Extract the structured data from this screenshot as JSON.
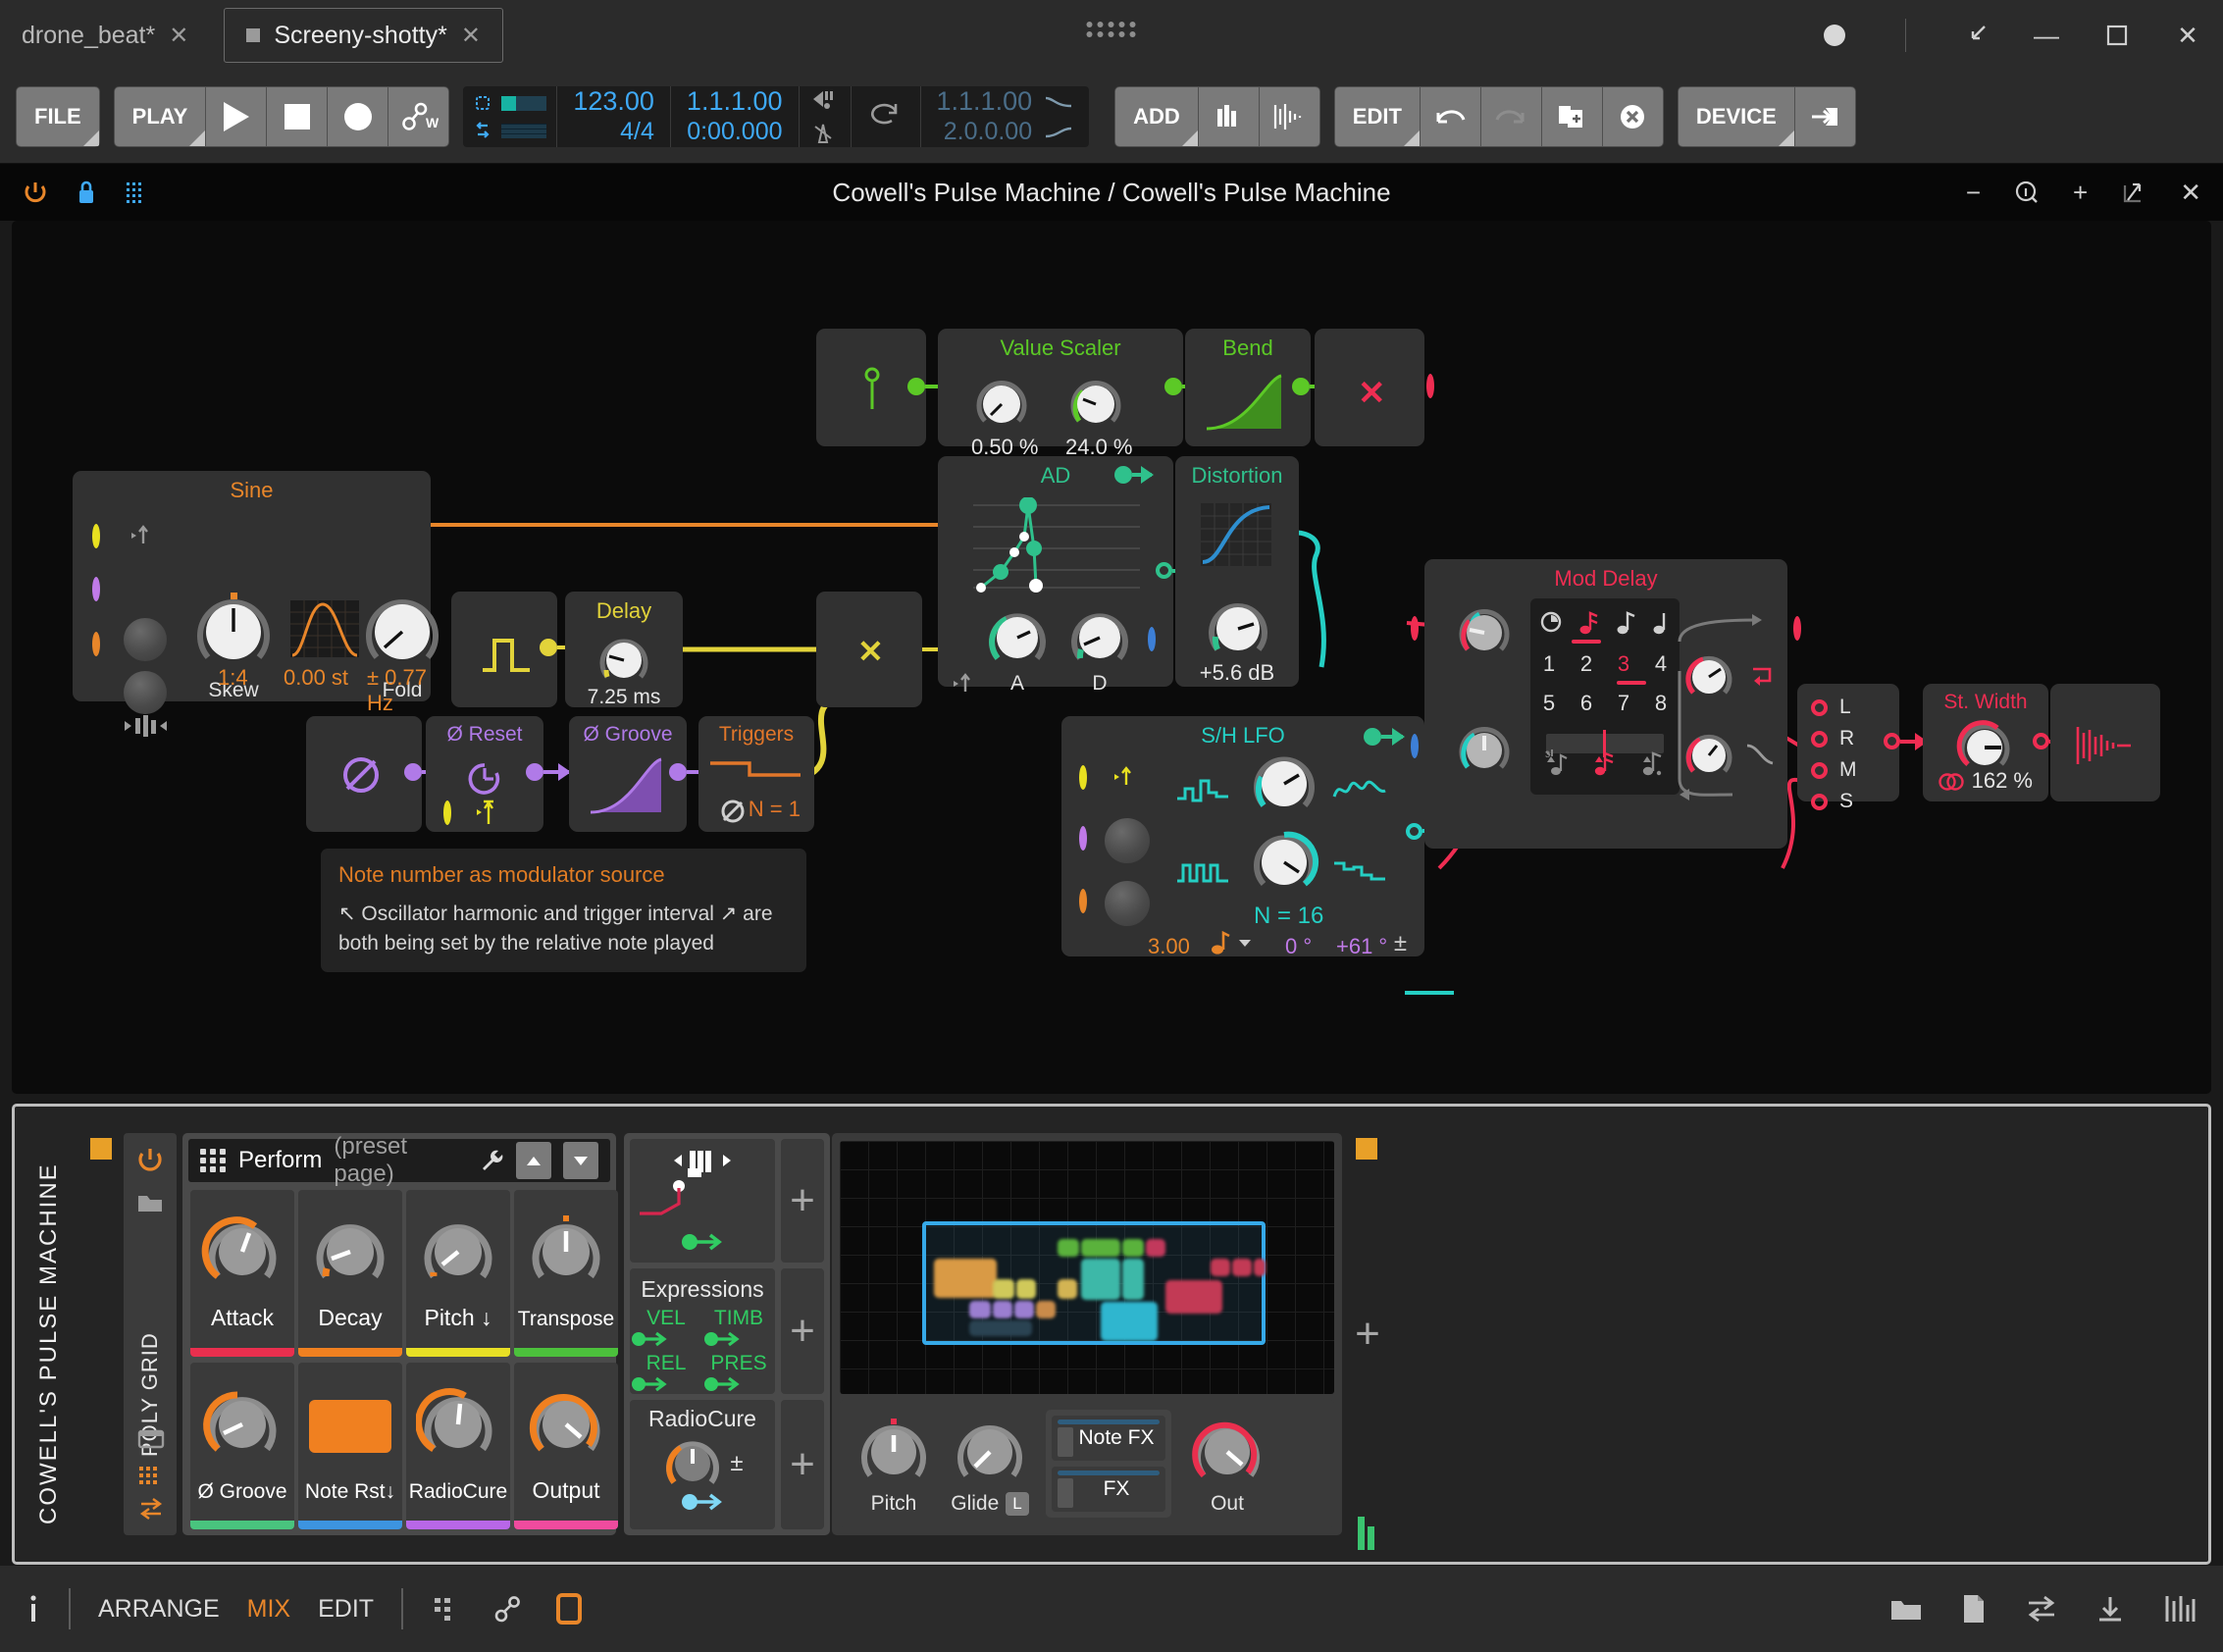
{
  "window": {
    "tabs": [
      {
        "label": "drone_beat*",
        "active": false,
        "close": "✕"
      },
      {
        "label": "Screeny-shotty*",
        "active": true,
        "close": "✕"
      }
    ],
    "controls": {
      "minimize": "—",
      "maximize": "❐",
      "close": "✕",
      "restore": "⤡"
    }
  },
  "transport": {
    "file_label": "FILE",
    "play_label": "PLAY",
    "buttons": [
      "play-icon",
      "stop-icon",
      "record-icon",
      "automation-write-icon"
    ],
    "tempo": "123.00",
    "signature": "4/4",
    "position_bars": "1.1.1.00",
    "position_time": "0:00.000",
    "loop_start": "1.1.1.00",
    "loop_end": "2.0.0.00",
    "add_label": "ADD",
    "edit_label": "EDIT",
    "device_label": "DEVICE"
  },
  "device_header": {
    "title": "Cowell's Pulse Machine / Cowell's Pulse Machine",
    "power_icon": "power-icon",
    "lock_icon": "lock-icon",
    "grid_icon": "grid-icon",
    "right_icons": [
      "minimize-icon",
      "info-icon",
      "plus-icon",
      "popout-icon",
      "close-icon"
    ]
  },
  "grid": {
    "modules": [
      {
        "name": "Sine",
        "color": "#e8862a",
        "params": [
          {
            "label": "Skew"
          },
          {
            "label": "Fold"
          }
        ],
        "values": [
          "1:4",
          "0.00 st",
          "± 0.77 Hz"
        ]
      },
      {
        "name": "Value Scaler",
        "color": "#5cc926",
        "values": [
          "0.50 %",
          "24.0 %"
        ]
      },
      {
        "name": "Bend",
        "color": "#5cc926",
        "values": []
      },
      {
        "name": "AD",
        "color": "#2fc18c",
        "params": [
          {
            "label": "A"
          },
          {
            "label": "D"
          }
        ],
        "values": []
      },
      {
        "name": "Distortion",
        "color": "#2fc18c",
        "values": [
          "+5.6 dB"
        ]
      },
      {
        "name": "Delay",
        "color": "#e2d33a",
        "values": [
          "7.25 ms"
        ]
      },
      {
        "name": "Ø Reset",
        "color": "#b07ae8",
        "values": []
      },
      {
        "name": "Ø Groove",
        "color": "#b07ae8",
        "values": []
      },
      {
        "name": "Triggers",
        "color": "#e2772a",
        "values": [
          "N = 1"
        ]
      },
      {
        "name": "S/H LFO",
        "color": "#25cfc4",
        "values": [
          "N = 16",
          "3.00",
          "0 °",
          "+61 °"
        ]
      },
      {
        "name": "Mod Delay",
        "color": "#ef2d52",
        "steps_top": [
          "1",
          "2",
          "3",
          "4"
        ],
        "steps_bottom": [
          "5",
          "6",
          "7",
          "8"
        ],
        "selected_step": "3"
      },
      {
        "name": "St. Width",
        "color": "#ef2d52",
        "values": [
          "162 %"
        ]
      }
    ],
    "channel_labels": [
      "L",
      "R",
      "M",
      "S"
    ],
    "note": {
      "title": "Note number as modulator source",
      "body": "↖ Oscillator harmonic and trigger interval ↗ are both being set by the relative note played"
    }
  },
  "bottom": {
    "device_name": "COWELL'S PULSE MACHINE",
    "engine_label": "POLY GRID",
    "preset_page": {
      "title": "Perform",
      "subtitle": "(preset page)",
      "wrench_icon": "wrench-icon",
      "up_icon": "chevron-up-icon",
      "down_icon": "chevron-down-icon"
    },
    "macros": [
      {
        "label": "Attack",
        "color": "#ea2f4e"
      },
      {
        "label": "Decay",
        "color": "#f08020"
      },
      {
        "label": "Pitch ↓",
        "color": "#e8e025"
      },
      {
        "label": "Transpose",
        "color": "#4cc13c"
      },
      {
        "label": "Ø Groove",
        "color": "#49c47e"
      },
      {
        "label": "Note Rst↓",
        "color": "#3d94e0"
      },
      {
        "label": "RadioCure",
        "color": "#b867e8"
      },
      {
        "label": "Output",
        "color": "#ef4b9e"
      }
    ],
    "expressions": {
      "title": "Expressions",
      "items": [
        "VEL",
        "TIMB",
        "REL",
        "PRES"
      ]
    },
    "radiocure": {
      "title": "RadioCure",
      "pm": "±"
    },
    "plus_label": "+",
    "voice_controls": [
      {
        "label": "Pitch"
      },
      {
        "label": "Glide"
      }
    ],
    "glide_badge": "L",
    "routing": [
      {
        "label": "Note FX"
      },
      {
        "label": "FX"
      }
    ],
    "out": {
      "label": "Out"
    }
  },
  "status_bar": {
    "info_icon": "info-icon",
    "views": [
      {
        "label": "ARRANGE",
        "active": false
      },
      {
        "label": "MIX",
        "active": true
      },
      {
        "label": "EDIT",
        "active": false
      }
    ],
    "right_icons": [
      "browser-icon",
      "notes-icon",
      "io-icon",
      "automation-icon",
      "mixer-icon"
    ]
  },
  "colors": {
    "accent_orange": "#e8862a",
    "blue": "#3fa9f5",
    "green": "#5cc926",
    "teal": "#2fc18c",
    "cyan": "#25cfc4",
    "yellow": "#e2d33a",
    "purple": "#b07ae8",
    "red": "#ef2d52"
  }
}
